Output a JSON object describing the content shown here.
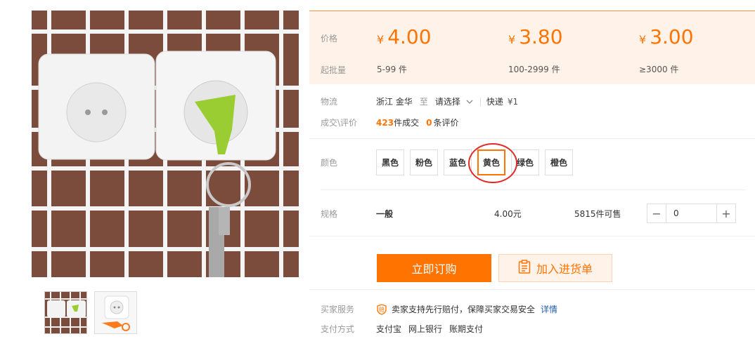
{
  "price_box": {
    "price_label": "价格",
    "moq_label": "起批量",
    "currency": "¥",
    "tiers": [
      {
        "price": "4.00",
        "range": "5-99 件"
      },
      {
        "price": "3.80",
        "range": "100-2999 件"
      },
      {
        "price": "3.00",
        "range": "≥3000 件"
      }
    ]
  },
  "logistics": {
    "label": "物流",
    "from_city": "浙江 金华",
    "to": "至",
    "select": "请选择",
    "express": "快递",
    "fee": "¥1"
  },
  "deals": {
    "label": "成交\\评价",
    "deal_count": "423",
    "deal_unit": "件成交",
    "review_count": "0",
    "review_unit": "条评价"
  },
  "colors": {
    "label": "颜色",
    "options": [
      "黑色",
      "粉色",
      "蓝色",
      "黄色",
      "绿色",
      "橙色"
    ],
    "selected": "黄色"
  },
  "spec": {
    "label": "规格",
    "name": "一般",
    "price": "4.00元",
    "stock": "5815件可售",
    "quantity": "0"
  },
  "actions": {
    "buy": "立即订购",
    "cart": "加入进货单"
  },
  "service": {
    "label": "买家服务",
    "text": "卖家支持先行赔付，保障买家交易安全",
    "link": "详情"
  },
  "payment": {
    "label": "支付方式",
    "methods": [
      "支付宝",
      "网上银行",
      "账期支付"
    ]
  },
  "colors_theme": {
    "accent": "#ff7300",
    "price_bg": "#fff2e8",
    "highlight_circle": "#e32a2a",
    "link": "#1e5ea8"
  }
}
